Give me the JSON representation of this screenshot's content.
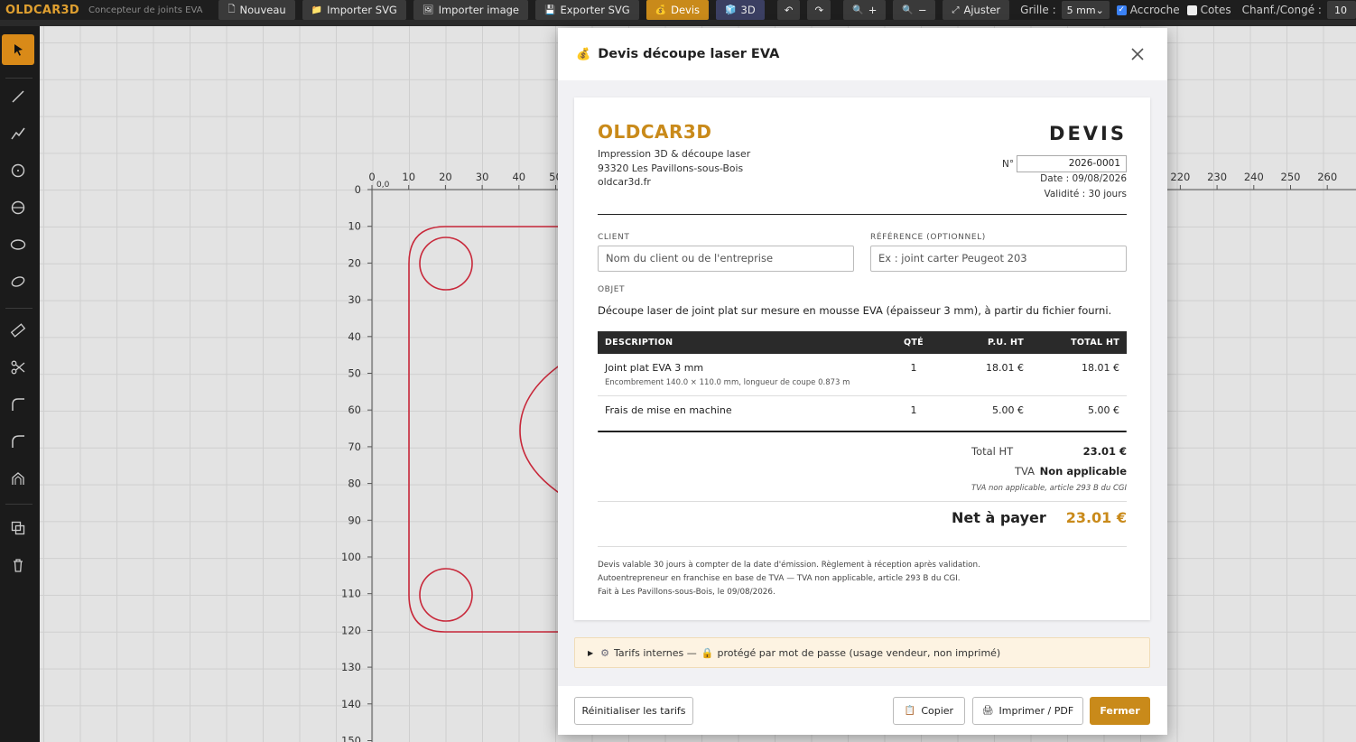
{
  "app": {
    "brand": "OLDCAR3D",
    "subtitle": "Concepteur de joints EVA"
  },
  "toolbar": {
    "new_label": "Nouveau",
    "import_svg_label": "Importer SVG",
    "import_image_label": "Importer image",
    "export_svg_label": "Exporter SVG",
    "quote_label": "Devis",
    "view3d_label": "3D",
    "undo_symbol": "↶",
    "redo_symbol": "↷",
    "zoom_in_label": "+",
    "zoom_out_label": "−",
    "fit_label": "Ajuster",
    "grid_label": "Grille :",
    "grid_value": "5 mm",
    "snap_label": "Accroche",
    "snap_checked": true,
    "dims_label": "Cotes",
    "dims_checked": false,
    "chamfer_label": "Chanf./Congé :",
    "chamfer_value": "10"
  },
  "tools": [
    "select-icon",
    "line-icon",
    "polyline-icon",
    "circle-icon",
    "circle-center-icon",
    "ellipse-icon",
    "rotated-ellipse-icon",
    "measure-icon",
    "cut-icon",
    "fillet-icon",
    "chamfer-icon",
    "offset-icon",
    "boolean-icon",
    "trash-icon"
  ],
  "ruler": {
    "x_ticks": [
      "0",
      "10",
      "20",
      "30",
      "40",
      "50",
      "220",
      "230",
      "240",
      "250",
      "260"
    ],
    "y_ticks": [
      "0",
      "10",
      "20",
      "30",
      "40",
      "50",
      "60",
      "70",
      "80",
      "90",
      "100",
      "110",
      "120",
      "130",
      "140",
      "150"
    ],
    "origin_label": "0,0"
  },
  "modal": {
    "title": "Devis découpe laser EVA",
    "title_icon": "money-bag-icon",
    "close_icon": "close-icon"
  },
  "quote": {
    "company": "OLDCAR3D",
    "company_lines": [
      "Impression 3D & découpe laser",
      "93320 Les Pavillons-sous-Bois",
      "oldcar3d.fr"
    ],
    "doc_title": "DEVIS",
    "number_label": "N°",
    "number": "2026-0001",
    "date_line": "Date : 09/08/2026",
    "validity_line": "Validité : 30 jours",
    "client_label": "CLIENT",
    "client_placeholder": "Nom du client ou de l'entreprise",
    "reference_label": "RÉFÉRENCE (OPTIONNEL)",
    "reference_placeholder": "Ex : joint carter Peugeot 203",
    "object_label": "OBJET",
    "object_text": "Découpe laser de joint plat sur mesure en mousse EVA (épaisseur 3 mm), à partir du fichier fourni.",
    "table_headers": [
      "DESCRIPTION",
      "QTÉ",
      "P.U. HT",
      "TOTAL HT"
    ],
    "rows": [
      {
        "description": "Joint plat EVA 3 mm",
        "detail": "Encombrement 140.0 × 110.0 mm, longueur de coupe 0.873 m",
        "qty": "1",
        "unit": "18.01 €",
        "total": "18.01 €"
      },
      {
        "description": "Frais de mise en machine",
        "detail": "",
        "qty": "1",
        "unit": "5.00 €",
        "total": "5.00 €"
      }
    ],
    "total_ht_label": "Total HT",
    "total_ht_value": "23.01 €",
    "tva_label": "TVA",
    "tva_value": "Non applicable",
    "tva_note": "TVA non applicable, article 293 B du CGI",
    "net_label": "Net à payer",
    "net_value": "23.01 €",
    "footer_lines": [
      "Devis valable 30 jours à compter de la date d'émission. Règlement à réception après validation.",
      "Autoentrepreneur en franchise en base de TVA — TVA non applicable, article 293 B du CGI.",
      "Fait à Les Pavillons-sous-Bois, le 09/08/2026."
    ]
  },
  "internal": {
    "label": "Tarifs internes —",
    "protected_text": "protégé par mot de passe (usage vendeur, non imprimé)"
  },
  "footer": {
    "reset_label": "Réinitialiser les tarifs",
    "copy_label": "Copier",
    "print_label": "Imprimer / PDF",
    "close_label": "Fermer"
  },
  "colors": {
    "accent": "#c98a1a",
    "shape_stroke": "#c8283a"
  }
}
